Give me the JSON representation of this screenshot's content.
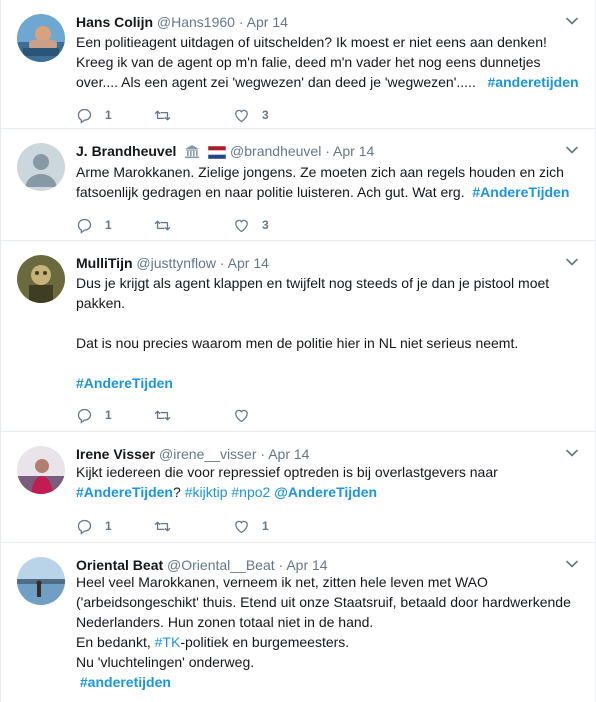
{
  "tweets": [
    {
      "name": "Hans Colijn",
      "handle": "@Hans1960",
      "separator": "·",
      "date": "Apr 14",
      "lines": [
        "Een politieagent uitdagen of uitschelden? Ik moest er niet eens aan denken!",
        "Kreeg ik van de agent op m'n falie, deed m'n vader het nog eens dunnetjes",
        "over.... Als een agent zei 'wegwezen' dan deed je 'wegwezen'....."
      ],
      "hashtag": "#anderetijden",
      "reply_count": "1",
      "retweet_count": "",
      "like_count": "3"
    },
    {
      "name": "J. Brandheuvel",
      "handle": "@brandheuvel",
      "separator": "·",
      "date": "Apr 14",
      "badges": [
        "classical-building-emoji",
        "netherlands-flag-emoji"
      ],
      "lines": [
        "Arme Marokkanen. Zielige jongens. Ze moeten zich aan regels houden en zich",
        "fatsoenlijk gedragen en naar politie luisteren. Ach gut. Wat erg."
      ],
      "hashtag": "#AndereTijden",
      "reply_count": "1",
      "retweet_count": "",
      "like_count": "3"
    },
    {
      "name": "MulliTijn",
      "handle": "@justtynflow",
      "separator": "·",
      "date": "Apr 14",
      "lines": [
        "Dus je krijgt als agent klappen en twijfelt nog steeds of je dan je pistool moet",
        "pakken."
      ],
      "line2": "Dat is nou precies waarom men de politie hier in NL niet serieus neemt.",
      "hashtag": "#AndereTijden",
      "reply_count": "1",
      "retweet_count": "",
      "like_count": ""
    },
    {
      "name": "Irene Visser",
      "handle": "@irene__visser",
      "separator": "·",
      "date": "Apr 14",
      "line1": "Kijkt iedereen die voor repressief optreden is bij overlastgevers naar",
      "tags": [
        "#AndereTijden",
        "?",
        "#kijktip",
        "#npo2",
        "@AndereTijden"
      ],
      "reply_count": "1",
      "retweet_count": "",
      "like_count": "1"
    },
    {
      "name": "Oriental Beat",
      "handle": "@Oriental__Beat",
      "separator": "·",
      "date": "Apr 14",
      "lines": [
        "Heel veel Marokkanen, verneem ik net, zitten hele leven met WAO",
        "('arbeidsongeschikt' thuis. Etend uit onze Staatsruif, betaald door hardwerkende",
        "Nederlanders. Hun zonen totaal niet in de hand."
      ],
      "line_tk_pre": "En bedankt, ",
      "line_tk_tag": "#TK",
      "line_tk_post": "-politiek en burgemeesters.",
      "line_last": "Nu 'vluchtelingen' onderweg.",
      "hashtag": "#anderetijden"
    }
  ],
  "colors": {
    "link": "#1b95e0",
    "muted": "#657786",
    "text": "#14171a",
    "border": "#e6ecf0"
  },
  "icons": [
    "reply-icon",
    "retweet-icon",
    "like-icon",
    "chevron-down-icon"
  ]
}
